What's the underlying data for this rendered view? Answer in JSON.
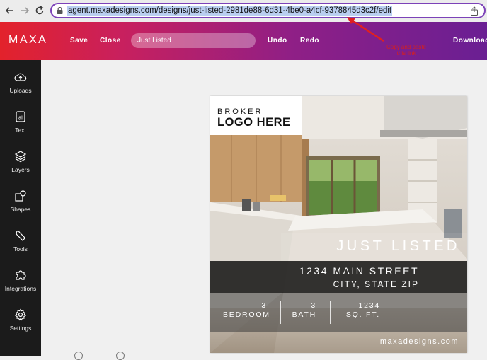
{
  "browser": {
    "url": "agent.maxadesigns.com/designs/just-listed-2981de88-6d31-4be0-a4cf-9378845d3c2f/edit",
    "back_icon": "arrow-left",
    "forward_icon": "arrow-right",
    "reload_icon": "reload",
    "lock_icon": "lock",
    "share_icon": "share"
  },
  "toolbar": {
    "logo": "MAXA",
    "save_label": "Save",
    "close_label": "Close",
    "title_value": "Just Listed",
    "undo_label": "Undo",
    "redo_label": "Redo",
    "download_label": "Download"
  },
  "annotation": {
    "text": "Copy and paste this link",
    "color": "#d42020"
  },
  "sidebar": {
    "items": [
      {
        "label": "Uploads",
        "icon": "upload-cloud"
      },
      {
        "label": "Text",
        "icon": "text-box"
      },
      {
        "label": "Layers",
        "icon": "layers"
      },
      {
        "label": "Shapes",
        "icon": "shapes"
      },
      {
        "label": "Tools",
        "icon": "wrench"
      },
      {
        "label": "Integrations",
        "icon": "puzzle"
      },
      {
        "label": "Settings",
        "icon": "gear"
      }
    ]
  },
  "poster": {
    "logo_line1": "BROKER",
    "logo_line2": "LOGO HERE",
    "headline": "JUST LISTED",
    "street": "1234 MAIN STREET",
    "city": "CITY, STATE ZIP",
    "stats": [
      {
        "value": "3",
        "label": "BEDROOM"
      },
      {
        "value": "3",
        "label": "BATH"
      },
      {
        "value": "1234",
        "label": "SQ. FT."
      }
    ],
    "website": "maxadesigns.com"
  },
  "colors": {
    "accent_start": "#e3222b",
    "accent_end": "#6a1f93",
    "sidebar_bg": "#1b1b1b"
  }
}
